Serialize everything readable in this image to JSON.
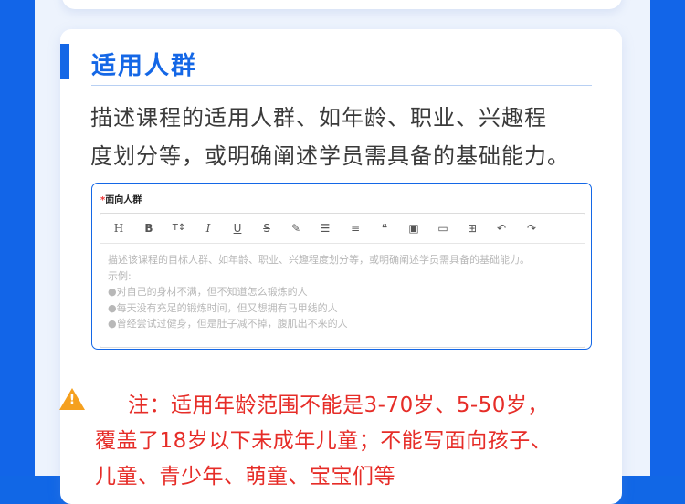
{
  "section": {
    "title": "适用人群",
    "description_lines": [
      "描述课程的适用人群、如年龄、职业、兴趣程",
      "度划分等，或明确阐述学员需具备的基础能力。"
    ]
  },
  "editor": {
    "required_mark": "*",
    "label": "面向人群",
    "toolbar": [
      {
        "name": "heading-icon",
        "glyph": "H"
      },
      {
        "name": "bold-icon",
        "glyph": "B"
      },
      {
        "name": "font-size-icon",
        "glyph": "T↕"
      },
      {
        "name": "italic-icon",
        "glyph": "I"
      },
      {
        "name": "underline-icon",
        "glyph": "U"
      },
      {
        "name": "strikethrough-icon",
        "glyph": "S"
      },
      {
        "name": "highlight-icon",
        "glyph": "✎"
      },
      {
        "name": "bullet-list-icon",
        "glyph": "☰"
      },
      {
        "name": "align-icon",
        "glyph": "≡"
      },
      {
        "name": "quote-icon",
        "glyph": "❝"
      },
      {
        "name": "image-icon",
        "glyph": "▣"
      },
      {
        "name": "file-icon",
        "glyph": "▭"
      },
      {
        "name": "table-icon",
        "glyph": "⊞"
      },
      {
        "name": "undo-icon",
        "glyph": "↶"
      },
      {
        "name": "redo-icon",
        "glyph": "↷"
      }
    ],
    "placeholder_lines": [
      "描述该课程的目标人群、如年龄、职业、兴趣程度划分等，或明确阐述学员需具备的基础能力。",
      "示例:",
      "●对自己的身材不满，但不知道怎么锻炼的人",
      "●每天没有充足的锻炼时间，但又想拥有马甲线的人",
      "●曾经尝试过健身，但是肚子减不掉，腹肌出不来的人"
    ]
  },
  "note": {
    "icon": "warning-icon",
    "lines": [
      "注：适用年龄范围不能是3-70岁、5-50岁，",
      "覆盖了18岁以下未成年儿童；不能写面向孩子、",
      "儿童、青少年、萌童、宝宝们等"
    ]
  }
}
